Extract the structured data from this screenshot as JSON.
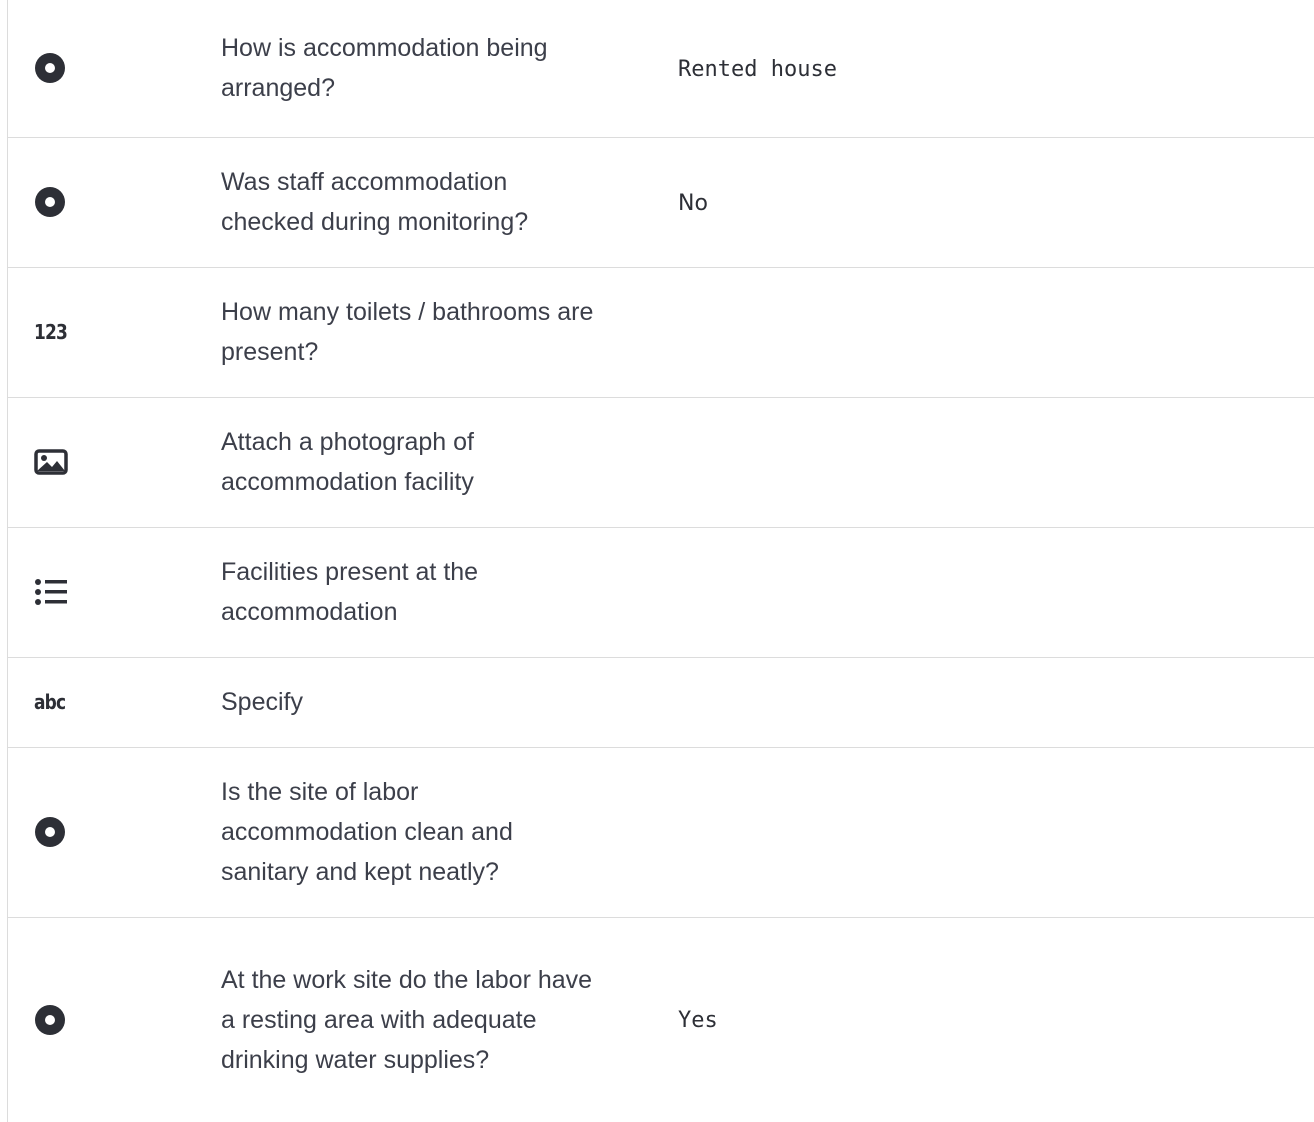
{
  "rows": [
    {
      "icon": "radio-select-icon",
      "question": "How is accommodation being arranged?",
      "answer": "Rented house"
    },
    {
      "icon": "radio-select-icon",
      "question": "Was staff accommodation checked during monitoring?",
      "answer": "No"
    },
    {
      "icon": "integer-icon",
      "icon_text": "123",
      "question": "How many toilets / bathrooms are present?",
      "answer": ""
    },
    {
      "icon": "image-icon",
      "question": "Attach a photograph of accommodation facility",
      "answer": ""
    },
    {
      "icon": "multiple-select-icon",
      "question": "Facilities present at the accommodation",
      "answer": ""
    },
    {
      "icon": "text-icon",
      "icon_text": "abc",
      "question": "Specify",
      "answer": ""
    },
    {
      "icon": "radio-select-icon",
      "question": "Is the site of labor accommodation clean and sanitary and kept neatly?",
      "answer": ""
    },
    {
      "icon": "radio-select-icon",
      "question": "At the work site do the labor have a resting area with adequate drinking water supplies?",
      "answer": "Yes"
    }
  ]
}
